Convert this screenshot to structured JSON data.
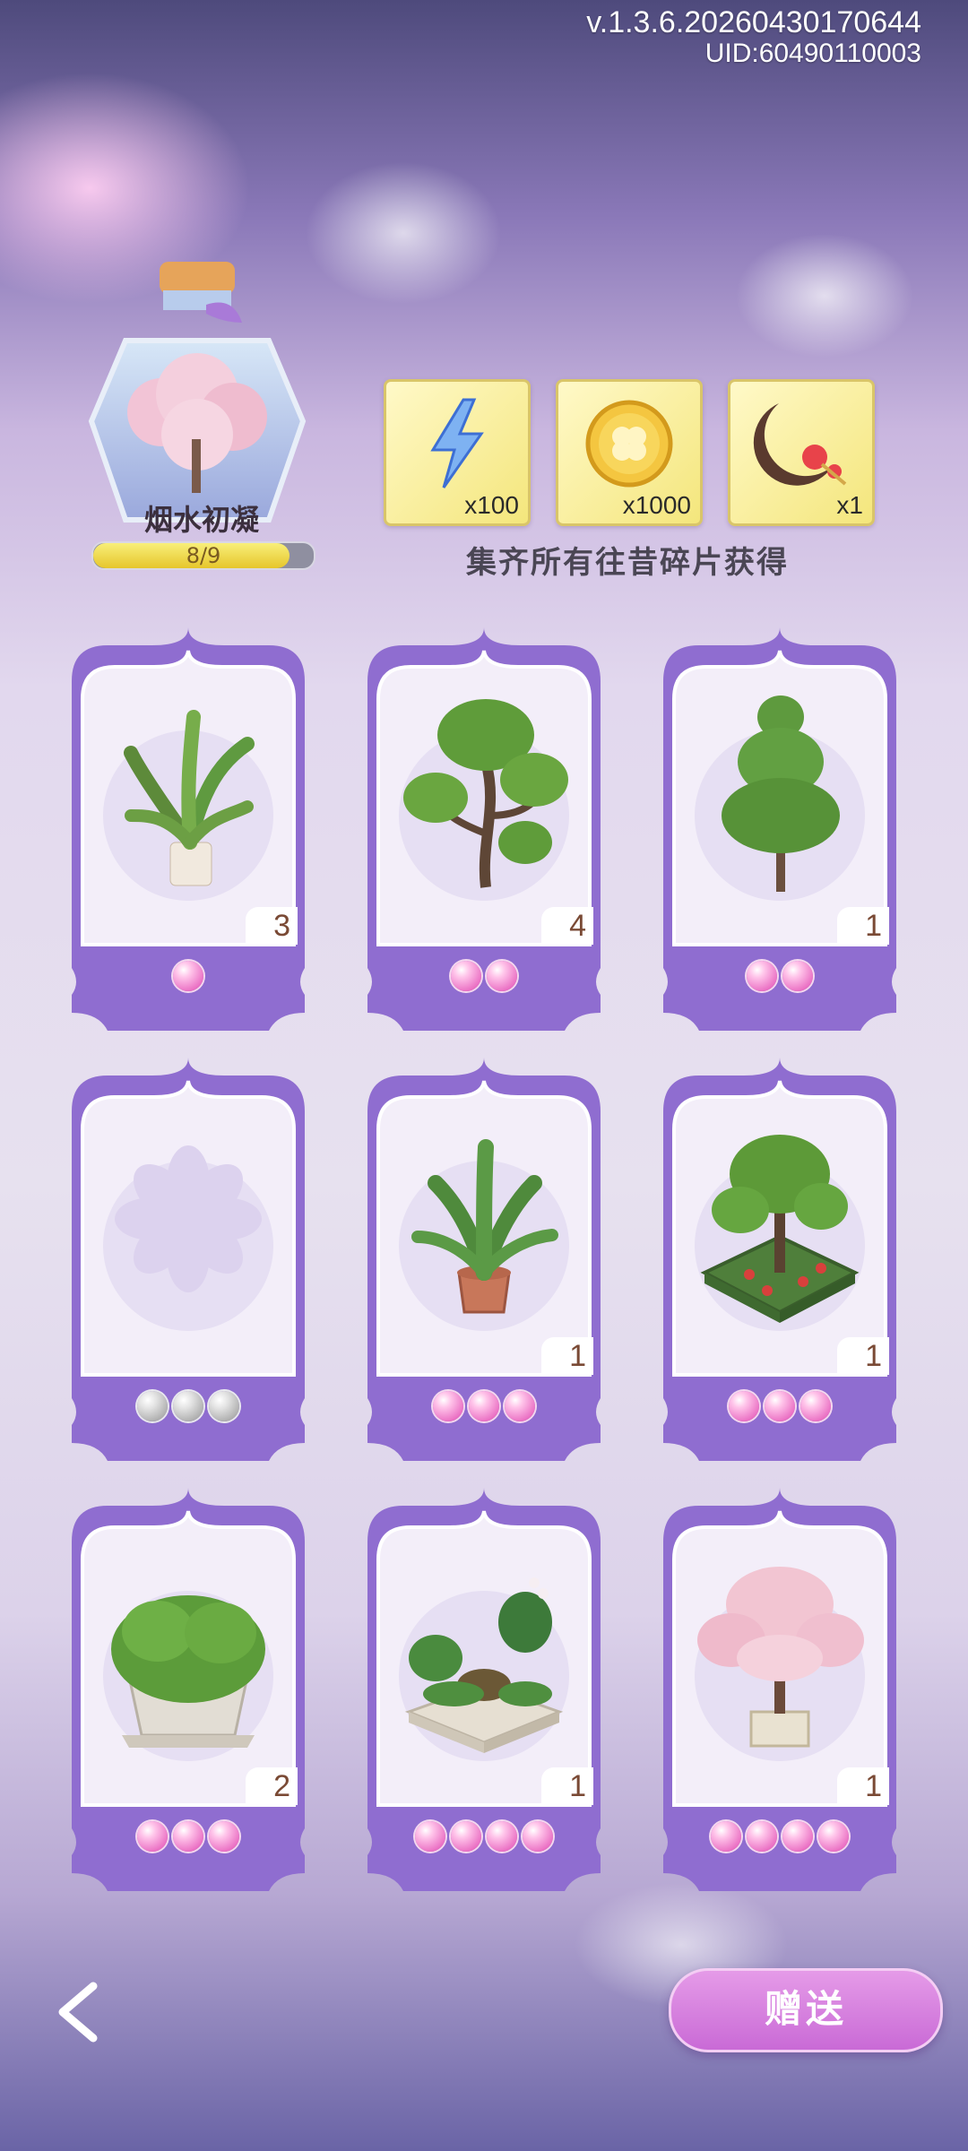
{
  "version": {
    "build": "v.1.3.6.20260430170644",
    "uid": "UID:60490110003"
  },
  "collection": {
    "name": "烟水初凝",
    "progress_text": "8/9",
    "progress_fraction": 0.889
  },
  "rewards": {
    "items": [
      {
        "icon": "lightning-icon",
        "count": "x100"
      },
      {
        "icon": "gold-coin-icon",
        "count": "x1000"
      },
      {
        "icon": "crescent-hairpin-icon",
        "count": "x1"
      }
    ],
    "caption": "集齐所有往昔碎片获得"
  },
  "cards": [
    {
      "plant": "potted-dieffenbachia",
      "count": "3",
      "pearls": 1,
      "owned": true
    },
    {
      "plant": "bonsai-cloud-tree",
      "count": "4",
      "pearls": 2,
      "owned": true
    },
    {
      "plant": "topiary-tree",
      "count": "1",
      "pearls": 2,
      "owned": true
    },
    {
      "plant": "empty-slot",
      "count": "",
      "pearls": 3,
      "owned": false
    },
    {
      "plant": "potted-bird-of-paradise",
      "count": "1",
      "pearls": 3,
      "owned": true
    },
    {
      "plant": "garden-bed-tree",
      "count": "1",
      "pearls": 3,
      "owned": true
    },
    {
      "plant": "square-planter-shrub",
      "count": "2",
      "pearls": 3,
      "owned": true
    },
    {
      "plant": "monstera-tortoise-garden",
      "count": "1",
      "pearls": 4,
      "owned": true
    },
    {
      "plant": "cherry-blossom-tree",
      "count": "1",
      "pearls": 4,
      "owned": true
    }
  ],
  "footer": {
    "back_icon": "chevron-left-icon",
    "gift_label": "赠送"
  },
  "colors": {
    "card_purple": "#8f6dd0",
    "pearl_pink": "#ea6fc3",
    "gift_button": "#d27ddc"
  }
}
